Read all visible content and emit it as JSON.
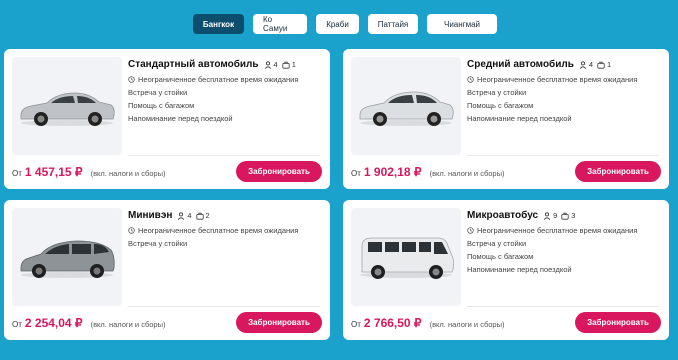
{
  "tabs": [
    "Бангкок",
    "Ко Самуи",
    "Краби",
    "Паттайя",
    "Чиангмай"
  ],
  "active_tab": "Бангкок",
  "cards": [
    {
      "name": "Стандартный автомобиль",
      "passengers": "4",
      "luggage": "1",
      "features": [
        "Неограниченное бесплатное время ожидания",
        "Встреча у стойки",
        "Помощь с багажом",
        "Напоминание перед поездкой"
      ],
      "price_prefix": "От",
      "price": "1 457,15 ₽",
      "price_note": "(вкл. налоги и сборы)",
      "book_label": "Забронировать",
      "car_color": "#bfc3c7"
    },
    {
      "name": "Средний автомобиль",
      "passengers": "4",
      "luggage": "1",
      "features": [
        "Неограниченное бесплатное время ожидания",
        "Встреча у стойки",
        "Помощь с багажом",
        "Напоминание перед поездкой"
      ],
      "price_prefix": "От",
      "price": "1 902,18 ₽",
      "price_note": "(вкл. налоги и сборы)",
      "book_label": "Забронировать",
      "car_color": "#dcdfe2"
    },
    {
      "name": "Минивэн",
      "passengers": "4",
      "luggage": "2",
      "features": [
        "Неограниченное бесплатное время ожидания",
        "Встреча у стойки"
      ],
      "price_prefix": "От",
      "price": "2 254,04 ₽",
      "price_note": "(вкл. налоги и сборы)",
      "book_label": "Забронировать",
      "car_color": "#8d9396"
    },
    {
      "name": "Микроавтобус",
      "passengers": "9",
      "luggage": "3",
      "features": [
        "Неограниченное бесплатное время ожидания",
        "Встреча у стойки",
        "Помощь с багажом",
        "Напоминание перед поездкой"
      ],
      "price_prefix": "От",
      "price": "2 766,50 ₽",
      "price_note": "(вкл. налоги и сборы)",
      "book_label": "Забронировать",
      "car_color": "#e9ebed"
    }
  ],
  "icons": {
    "passenger": "person-icon",
    "luggage": "suitcase-icon",
    "feature_first": "clock-icon"
  },
  "colors": {
    "background": "#1aa1cc",
    "active_tab": "#0d4e6f",
    "price": "#d6175f",
    "button": "#d8175e"
  }
}
